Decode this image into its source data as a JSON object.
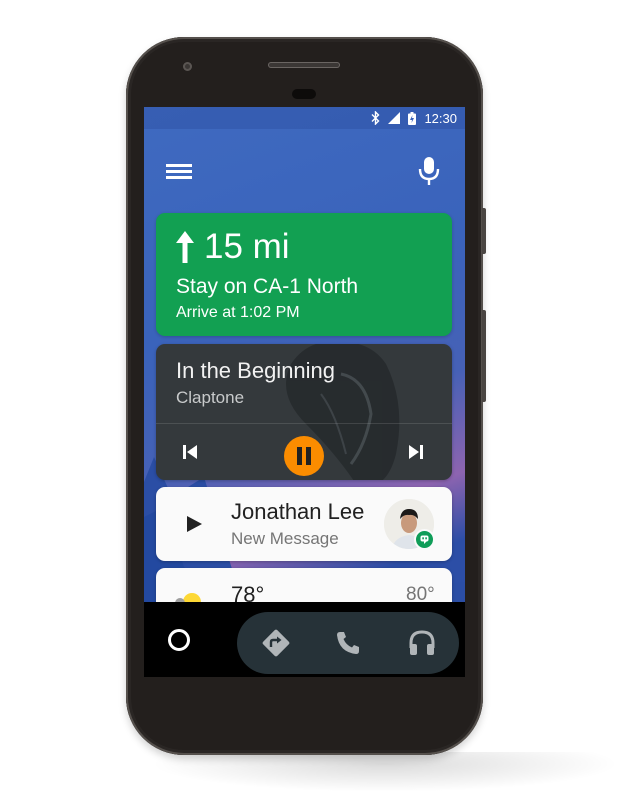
{
  "status_bar": {
    "icons": [
      "bluetooth-icon",
      "cell-signal-icon",
      "battery-charging-icon"
    ],
    "time": "12:30"
  },
  "top_bar": {
    "menu_icon": "hamburger-menu-icon",
    "voice_icon": "microphone-icon"
  },
  "navigation_card": {
    "direction_icon": "arrow-up-icon",
    "distance": "15 mi",
    "instruction": "Stay on CA-1 North",
    "arrival": "Arrive at 1:02 PM",
    "color": "#12a052"
  },
  "media_card": {
    "title": "In the Beginning",
    "artist": "Claptone",
    "controls": {
      "previous": "skip-previous-icon",
      "play_pause": "pause-icon",
      "next": "skip-next-icon"
    },
    "accent": "#fb8c00"
  },
  "message_card": {
    "action_icon": "play-icon",
    "contact_name": "Jonathan Lee",
    "subtitle": "New Message",
    "badge_icon": "hangouts-icon"
  },
  "weather_card": {
    "icon": "partly-cloudy-icon",
    "temperature": "78°",
    "high": "80°"
  },
  "bottom_nav": {
    "home_icon": "home-circle-icon",
    "apps": [
      {
        "name": "navigation",
        "icon": "directions-icon"
      },
      {
        "name": "phone",
        "icon": "phone-icon"
      },
      {
        "name": "audio",
        "icon": "headphones-icon"
      }
    ]
  }
}
